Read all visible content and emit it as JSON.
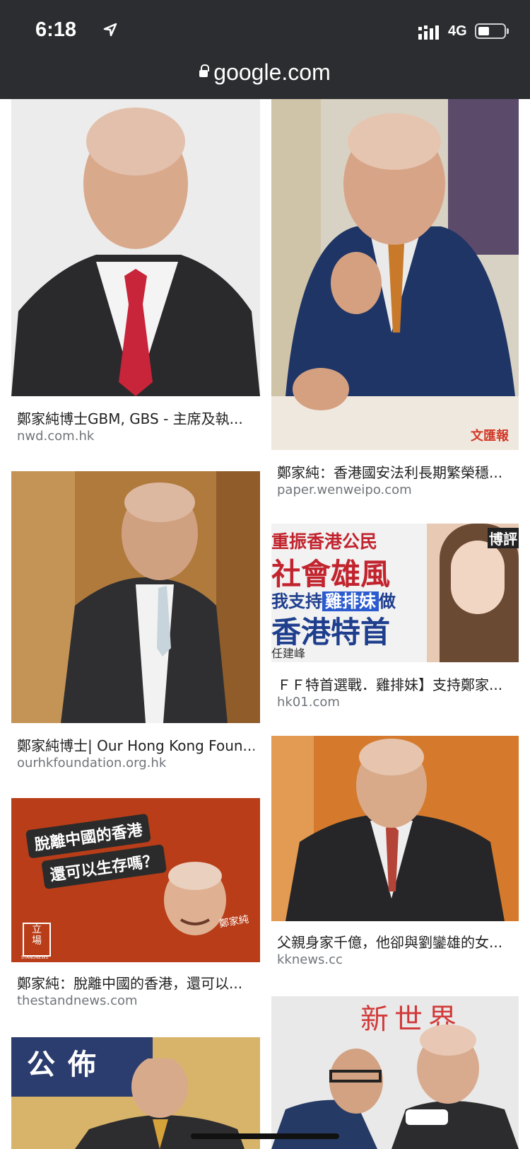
{
  "status_bar": {
    "time": "6:18",
    "network": "4G",
    "battery_fraction": 0.45
  },
  "address_bar": {
    "domain": "google.com"
  },
  "results": [
    {
      "caption": "鄭家純博士GBM, GBS - 主席及執...",
      "source": "nwd.com.hk"
    },
    {
      "caption": "鄭家純：香港國安法利長期繁榮穩...",
      "source": "paper.wenweipo.com",
      "watermark": "文匯報"
    },
    {
      "caption": "鄭家純博士| Our Hong Kong Foun...",
      "source": "ourhkfoundation.org.hk"
    },
    {
      "caption": "ＦＦ特首選戰．雞排妹】支持鄭家...",
      "source": "hk01.com",
      "image_text": {
        "line1": "重振香港公民",
        "line2": "社會雄風",
        "line3a": "我支持",
        "line3b": "雞排妹",
        "line3c": "做",
        "line4": "香港特首",
        "signature": "任建峰",
        "corner": "博評"
      }
    },
    {
      "caption": "父親身家千億，他卻與劉鑾雄的女...",
      "source": "kknews.cc"
    },
    {
      "caption": "鄭家純：脫離中國的香港，還可以...",
      "source": "thestandnews.com",
      "image_text": {
        "bubble_line1": "脫離中國的香港",
        "bubble_line2": "還可以生存嗎？",
        "name": "鄭家純",
        "logo_line1": "立",
        "logo_line2": "場",
        "logo_small": "STANDNEWS"
      }
    },
    {
      "caption": "",
      "source": "",
      "image_text": {
        "sign": "公佈"
      }
    },
    {
      "caption": "",
      "source": "",
      "image_text": {
        "banner": "新世界"
      }
    }
  ]
}
